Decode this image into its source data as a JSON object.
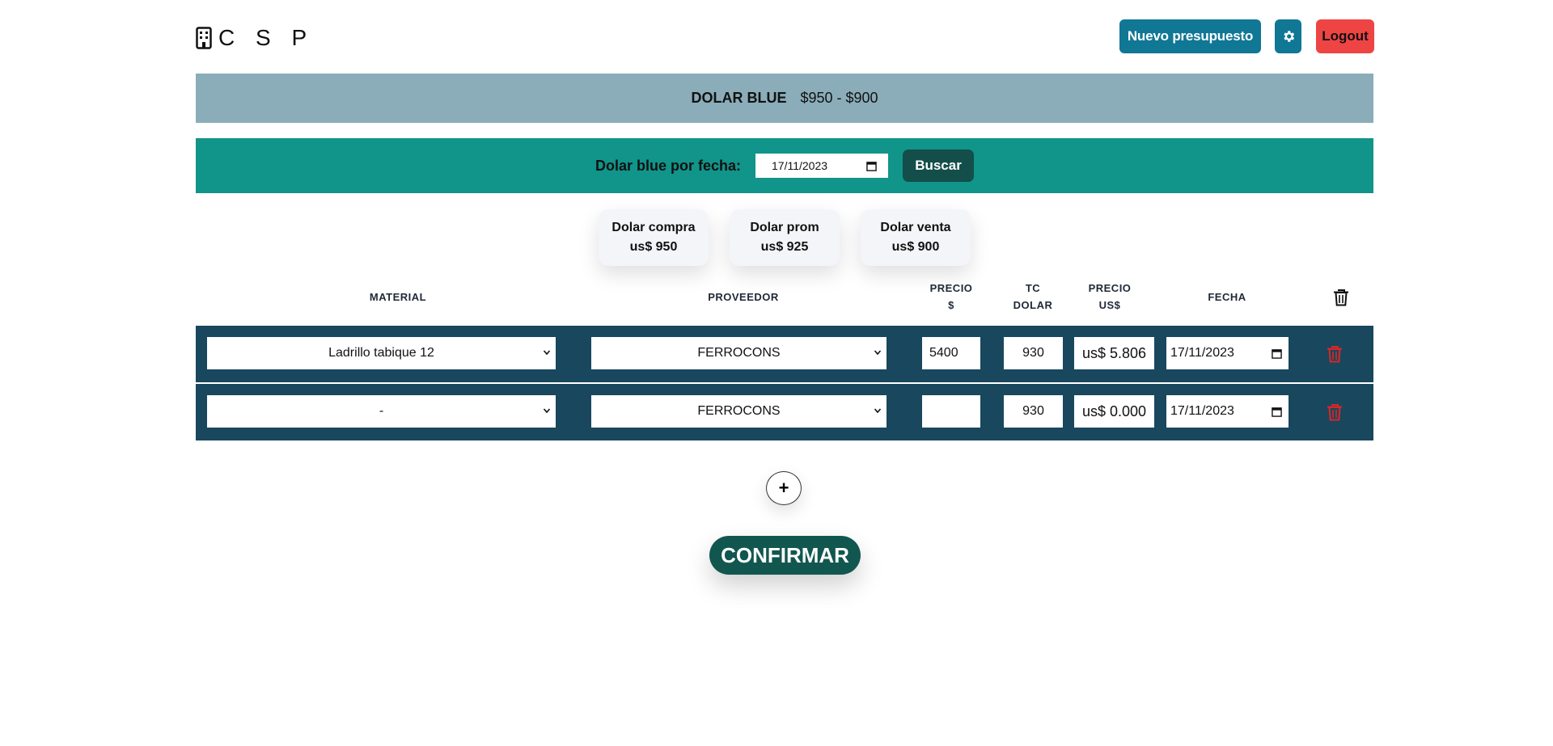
{
  "header": {
    "logo_text": "C S P",
    "new_budget_label": "Nuevo presupuesto",
    "logout_label": "Logout"
  },
  "dolar_blue": {
    "label": "DOLAR BLUE",
    "value": "$950 - $900"
  },
  "date_search": {
    "label": "Dolar blue por fecha:",
    "date_value": "17/11/2023",
    "button_label": "Buscar"
  },
  "cards": [
    {
      "title": "Dolar compra",
      "value": "us$ 950"
    },
    {
      "title": "Dolar prom",
      "value": "us$ 925"
    },
    {
      "title": "Dolar venta",
      "value": "us$ 900"
    }
  ],
  "table": {
    "headers": {
      "material": "MATERIAL",
      "proveedor": "PROVEEDOR",
      "precio_ars_1": "PRECIO",
      "precio_ars_2": "$",
      "tc_1": "TC",
      "tc_2": "DOLAR",
      "precio_usd_1": "PRECIO",
      "precio_usd_2": "US$",
      "fecha": "FECHA"
    },
    "rows": [
      {
        "material": "Ladrillo tabique 12",
        "proveedor": "FERROCONS",
        "precio": "5400",
        "tc": "930",
        "precio_usd": "us$ 5.806",
        "fecha": "17/11/2023"
      },
      {
        "material": "-",
        "proveedor": "FERROCONS",
        "precio": "",
        "tc": "930",
        "precio_usd": "us$ 0.000",
        "fecha": "17/11/2023"
      }
    ]
  },
  "actions": {
    "add_label": "+",
    "confirm_label": "CONFIRMAR"
  },
  "colors": {
    "primary": "#107795",
    "danger": "#ef4444",
    "dolar_band": "#8aadb9",
    "date_band": "#11948a",
    "row_bg": "#19475e",
    "confirm": "#12574f"
  }
}
